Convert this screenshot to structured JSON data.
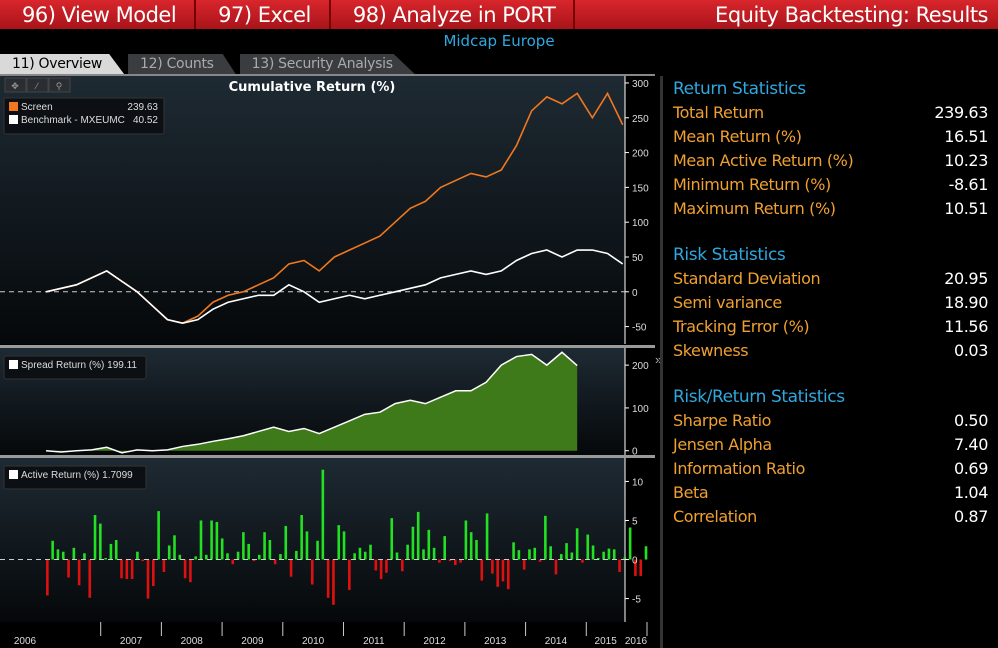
{
  "topbar": {
    "buttons": [
      "96) View Model",
      "97) Excel",
      "98) Analyze in PORT"
    ],
    "title": "Equity Backtesting: Results"
  },
  "subtitle": "Midcap Europe",
  "tabs": [
    "11) Overview",
    "12) Counts",
    "13) Security Analysis"
  ],
  "colors": {
    "screen": "#f07820",
    "benchmark": "#ffffff",
    "spread_fill": "#3f7a1a",
    "pos": "#22e022",
    "neg": "#e01010",
    "header": "#2fa8e0",
    "label": "#f0a030"
  },
  "chart_data": [
    {
      "type": "line",
      "title": "Cumulative Return (%)",
      "x_start": 2006.1,
      "x_step": 0.25,
      "ylim": [
        -75,
        310
      ],
      "yticks": [
        300,
        250,
        200,
        150,
        100,
        50,
        0,
        -50
      ],
      "series": [
        {
          "name": "Screen",
          "last": "239.63",
          "values": [
            0,
            5,
            10,
            20,
            30,
            15,
            0,
            -20,
            -40,
            -45,
            -35,
            -15,
            -5,
            0,
            10,
            20,
            40,
            45,
            30,
            50,
            60,
            70,
            80,
            100,
            120,
            130,
            150,
            160,
            170,
            165,
            175,
            210,
            260,
            280,
            270,
            285,
            250,
            285,
            240
          ]
        },
        {
          "name": "Benchmark - MXEUMC",
          "last": "40.52",
          "values": [
            0,
            5,
            10,
            20,
            30,
            15,
            0,
            -20,
            -40,
            -45,
            -40,
            -25,
            -15,
            -10,
            -5,
            -5,
            10,
            0,
            -15,
            -10,
            -5,
            -10,
            -5,
            0,
            5,
            10,
            20,
            25,
            30,
            25,
            30,
            45,
            55,
            60,
            50,
            60,
            60,
            55,
            40
          ]
        }
      ]
    },
    {
      "type": "area",
      "title": "Spread Return (%)",
      "last": "199.11",
      "x_start": 2006.1,
      "x_step": 0.25,
      "ylim": [
        -10,
        240
      ],
      "yticks": [
        200,
        100,
        0
      ],
      "values": [
        0,
        -3,
        0,
        2,
        8,
        -5,
        2,
        0,
        2,
        10,
        15,
        22,
        28,
        35,
        45,
        55,
        45,
        52,
        40,
        55,
        70,
        85,
        90,
        110,
        118,
        110,
        125,
        140,
        140,
        160,
        200,
        220,
        225,
        200,
        230,
        199
      ]
    },
    {
      "type": "bar",
      "title": "Active Return (%)",
      "last": "1.7099",
      "x_start": 2006.1,
      "x_end": 2016.05,
      "ylim": [
        -8,
        13
      ],
      "yticks": [
        10,
        5,
        0,
        -5
      ],
      "values": [
        -4.6,
        2.4,
        1.3,
        1.0,
        -2.3,
        1.5,
        -3.3,
        0.8,
        -4.9,
        5.7,
        4.6,
        0.2,
        2.0,
        2.5,
        -2.4,
        -2.5,
        -2.5,
        1.0,
        -0.2,
        -5.0,
        -3.4,
        6.2,
        -1.6,
        1.8,
        3.1,
        0.6,
        -2.4,
        -2.9,
        0.4,
        5.0,
        0.6,
        5.0,
        4.8,
        2.7,
        0.8,
        -0.6,
        1.0,
        3.5,
        2.0,
        -0.2,
        0.6,
        3.5,
        2.5,
        -0.6,
        0.7,
        4.3,
        -2.2,
        1.1,
        5.7,
        3.6,
        -3.2,
        2.4,
        11.5,
        -4.9,
        -5.8,
        4.4,
        3.6,
        -3.9,
        0.8,
        1.5,
        1.0,
        1.9,
        -1.4,
        -2.5,
        -1.7,
        5.3,
        0.9,
        -1.5,
        1.9,
        4.2,
        6.1,
        1.3,
        3.8,
        1.5,
        -0.4,
        3.0,
        -0.2,
        -0.7,
        -0.4,
        5.0,
        3.5,
        2.5,
        -2.7,
        5.9,
        -1.8,
        -3.5,
        -2.8,
        -3.8,
        2.2,
        1.2,
        -1.3,
        1.3,
        1.5,
        -0.3,
        5.6,
        1.7,
        -1.9,
        0.7,
        2.1,
        0.9,
        4.0,
        -0.4,
        3.2,
        1.8,
        0.2,
        1.0,
        1.4,
        1.3,
        -1.6,
        0.3,
        4.1,
        -2.1,
        -2.1,
        1.7
      ]
    },
    {
      "type": "axis",
      "years": [
        "2006",
        "2007",
        "2008",
        "2009",
        "2010",
        "2011",
        "2012",
        "2013",
        "2014",
        "2015",
        "2016"
      ]
    }
  ],
  "stats": [
    {
      "title": "Return Statistics",
      "rows": [
        [
          "Total Return",
          "239.63"
        ],
        [
          "Mean Return (%)",
          "16.51"
        ],
        [
          "Mean Active Return (%)",
          "10.23"
        ],
        [
          "Minimum Return (%)",
          "-8.61"
        ],
        [
          "Maximum Return (%)",
          "10.51"
        ]
      ]
    },
    {
      "title": "Risk Statistics",
      "rows": [
        [
          "Standard Deviation",
          "20.95"
        ],
        [
          "Semi variance",
          "18.90"
        ],
        [
          "Tracking Error (%)",
          "11.56"
        ],
        [
          "Skewness",
          "0.03"
        ]
      ]
    },
    {
      "title": "Risk/Return Statistics",
      "rows": [
        [
          "Sharpe Ratio",
          "0.50"
        ],
        [
          "Jensen Alpha",
          "7.40"
        ],
        [
          "Information Ratio",
          "0.69"
        ],
        [
          "Beta",
          "1.04"
        ],
        [
          "Correlation",
          "0.87"
        ]
      ]
    }
  ]
}
